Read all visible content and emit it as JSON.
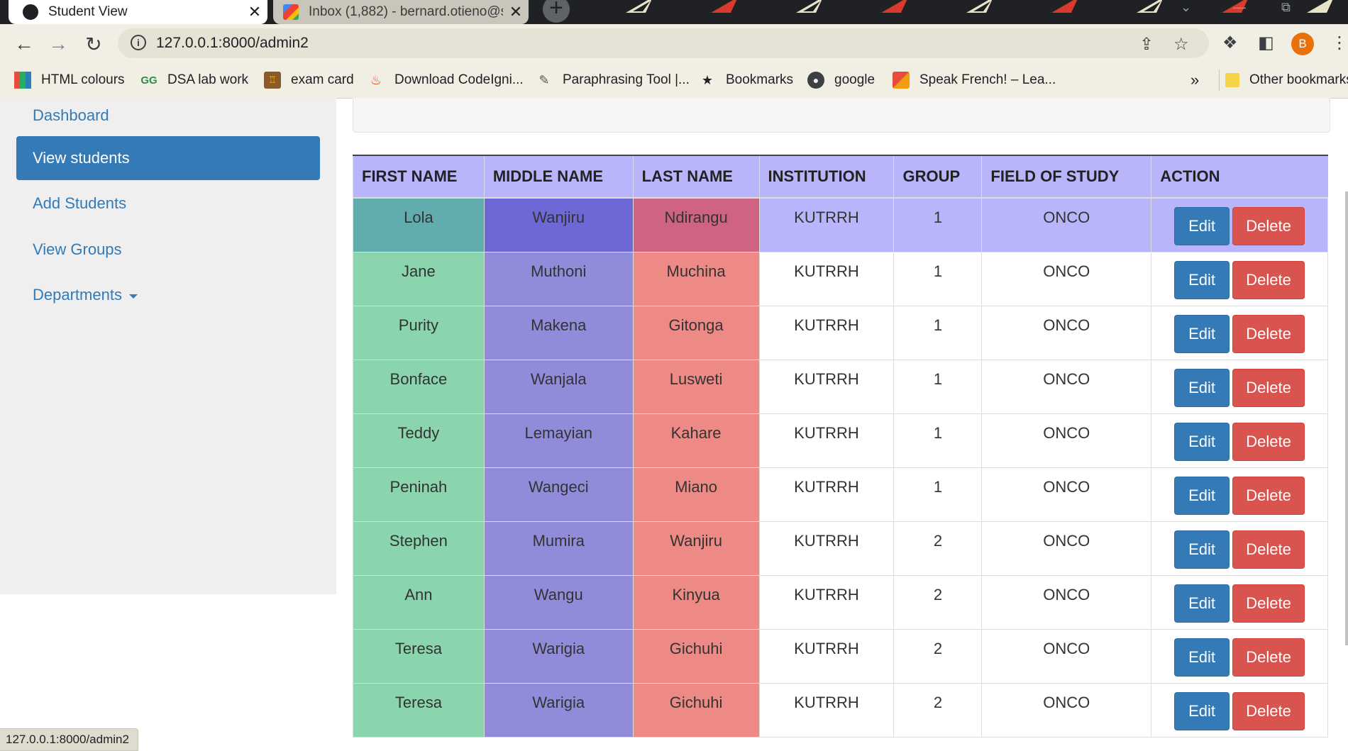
{
  "browser": {
    "tabs": [
      {
        "title": "Student View",
        "active": true
      },
      {
        "title": "Inbox (1,882) - bernard.otieno@s",
        "active": false
      }
    ],
    "new_tab": "+",
    "url": "127.0.0.1:8000/admin2",
    "profile_initial": "B",
    "bookmarks": [
      {
        "label": "HTML colours",
        "icon": "grid-icon"
      },
      {
        "label": "DSA lab work",
        "icon": "geeks-icon"
      },
      {
        "label": "exam card",
        "icon": "crest-icon"
      },
      {
        "label": "Download CodeIgni...",
        "icon": "flame-icon"
      },
      {
        "label": "Paraphrasing Tool |...",
        "icon": "quill-icon"
      },
      {
        "label": "Bookmarks",
        "icon": "star-icon"
      },
      {
        "label": "google",
        "icon": "globe-icon"
      },
      {
        "label": "Speak French! – Lea...",
        "icon": "flag-icon"
      }
    ],
    "bookmarks_overflow": "»",
    "other_bookmarks": "Other bookmarks",
    "status_url": "127.0.0.1:8000/admin2"
  },
  "sidebar": {
    "items": [
      {
        "label": "Dashboard"
      },
      {
        "label": "View students"
      },
      {
        "label": "Add Students"
      },
      {
        "label": "View Groups"
      },
      {
        "label": "Departments"
      }
    ]
  },
  "table": {
    "headers": [
      "FIRST NAME",
      "MIDDLE NAME",
      "LAST NAME",
      "INSTITUTION",
      "GROUP",
      "FIELD OF STUDY",
      "ACTION"
    ],
    "edit_label": "Edit",
    "delete_label": "Delete",
    "rows": [
      {
        "first": "Lola",
        "middle": "Wanjiru",
        "last": "Ndirangu",
        "institution": "KUTRRH",
        "group": "1",
        "field": "ONCO"
      },
      {
        "first": "Jane",
        "middle": "Muthoni",
        "last": "Muchina",
        "institution": "KUTRRH",
        "group": "1",
        "field": "ONCO"
      },
      {
        "first": "Purity",
        "middle": "Makena",
        "last": "Gitonga",
        "institution": "KUTRRH",
        "group": "1",
        "field": "ONCO"
      },
      {
        "first": "Bonface",
        "middle": "Wanjala",
        "last": "Lusweti",
        "institution": "KUTRRH",
        "group": "1",
        "field": "ONCO"
      },
      {
        "first": "Teddy",
        "middle": "Lemayian",
        "last": "Kahare",
        "institution": "KUTRRH",
        "group": "1",
        "field": "ONCO"
      },
      {
        "first": "Peninah",
        "middle": "Wangeci",
        "last": "Miano",
        "institution": "KUTRRH",
        "group": "1",
        "field": "ONCO"
      },
      {
        "first": "Stephen",
        "middle": "Mumira",
        "last": "Wanjiru",
        "institution": "KUTRRH",
        "group": "2",
        "field": "ONCO"
      },
      {
        "first": "Ann",
        "middle": "Wangu",
        "last": "Kinyua",
        "institution": "KUTRRH",
        "group": "2",
        "field": "ONCO"
      },
      {
        "first": "Teresa",
        "middle": "Warigia",
        "last": "Gichuhi",
        "institution": "KUTRRH",
        "group": "2",
        "field": "ONCO"
      },
      {
        "first": "Teresa",
        "middle": "Warigia",
        "last": "Gichuhi",
        "institution": "KUTRRH",
        "group": "2",
        "field": "ONCO"
      }
    ]
  },
  "colors": {
    "primary": "#337ab7",
    "danger": "#d9534f",
    "header_bg": "#b8b5fb",
    "first_col": "#8ad4ae",
    "middle_col": "#908cd9",
    "last_col": "#ed8a86"
  }
}
